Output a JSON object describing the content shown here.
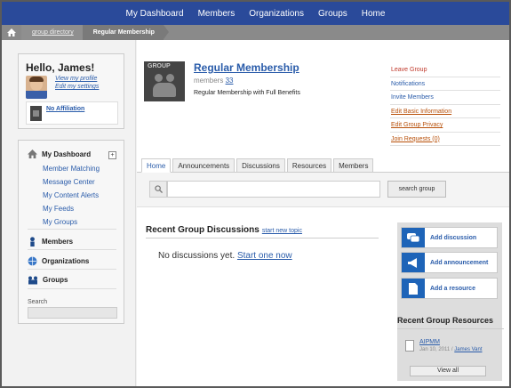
{
  "topnav": [
    "My Dashboard",
    "Members",
    "Organizations",
    "Groups",
    "Home"
  ],
  "breadcrumb": [
    "group directory",
    "Regular Membership"
  ],
  "user": {
    "hello": "Hello, James!",
    "view_profile": "View my profile",
    "edit_settings": "Edit my settings",
    "affiliation": "No Affiliation"
  },
  "sidebar": {
    "dashboard": "My Dashboard",
    "sub": [
      "Member Matching",
      "Message Center",
      "My Content Alerts",
      "My Feeds",
      "My Groups"
    ],
    "members": "Members",
    "organizations": "Organizations",
    "groups": "Groups",
    "search_label": "Search",
    "toggle": "+"
  },
  "group": {
    "image_label": "GROUP",
    "title": "Regular Membership",
    "members_label": "members",
    "members_count": "33",
    "description": "Regular Membership with Full Benefits"
  },
  "actions": [
    "Leave Group",
    "Notifications",
    "Invite Members",
    "Edit Basic Information",
    "Edit Group Privacy",
    "Join Requests (0)"
  ],
  "tabs": [
    "Home",
    "Announcements",
    "Discussions",
    "Resources",
    "Members"
  ],
  "search": {
    "button": "search group"
  },
  "discussions": {
    "title": "Recent Group Discussions",
    "start_link": "start new topic",
    "empty": "No discussions yet.",
    "empty_link": "Start one now"
  },
  "side_buttons": [
    "Add discussion",
    "Add announcement",
    "Add a resource"
  ],
  "resources": {
    "title": "Recent Group Resources",
    "item": "AIPMM",
    "date": "Jan 10, 2011 / ",
    "author": "James Vant",
    "view_all": "View all"
  },
  "colors": {
    "nav": "#2a4a9a",
    "link": "#2a5caa",
    "action_red": "#c0392b",
    "button_blue": "#1e64b8"
  }
}
